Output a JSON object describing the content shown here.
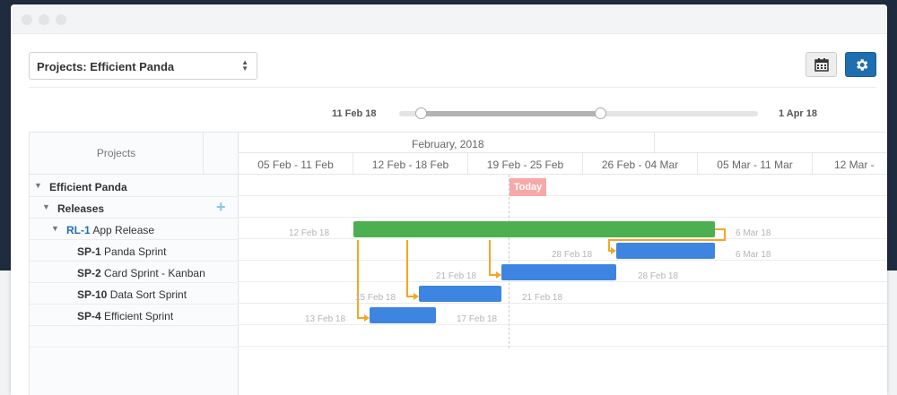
{
  "toolbar": {
    "project_select_value": "Projects: Efficient Panda",
    "calendar_button": "calendar-icon",
    "settings_button": "gear-icon",
    "accent_color": "#1f6fb0"
  },
  "date_range": {
    "start_label": "11 Feb 18",
    "end_label": "1 Apr 18",
    "selected_range_fraction": [
      0.06,
      0.56
    ]
  },
  "grid": {
    "header": "Projects",
    "rows": [
      {
        "code": "",
        "label": "Efficient Panda",
        "level": 0
      },
      {
        "code": "",
        "label": "Releases",
        "level": 1
      },
      {
        "code": "RL-1",
        "label": " App Release",
        "level": 2
      },
      {
        "code": "SP-1",
        "label": " Panda Sprint",
        "level": 3
      },
      {
        "code": "SP-2",
        "label": " Card Sprint - Kanban",
        "level": 3
      },
      {
        "code": "SP-10",
        "label": " Data Sort Sprint",
        "level": 3
      },
      {
        "code": "SP-4",
        "label": " Efficient Sprint",
        "level": 3
      }
    ]
  },
  "timeline": {
    "month": "February, 2018",
    "weeks": [
      "05 Feb - 11 Feb",
      "12 Feb - 18 Feb",
      "19 Feb - 25 Feb",
      "26 Feb - 04 Mar",
      "05 Mar - 11 Mar",
      "12 Mar -"
    ],
    "today_label": "Today"
  },
  "bars": [
    {
      "id": "RL-1",
      "start_label": "12 Feb 18",
      "end_label": "6 Mar 18",
      "color": "#4caf50"
    },
    {
      "id": "SP-1",
      "start_label": "28 Feb 18",
      "end_label": "6 Mar 18",
      "color": "#3d85e0"
    },
    {
      "id": "SP-2",
      "start_label": "21 Feb 18",
      "end_label": "28 Feb 18",
      "color": "#3d85e0"
    },
    {
      "id": "SP-10",
      "start_label": "15 Feb 18",
      "end_label": "21 Feb 18",
      "color": "#3d85e0"
    },
    {
      "id": "SP-4",
      "start_label": "13 Feb 18",
      "end_label": "17 Feb 18",
      "color": "#3d85e0"
    }
  ],
  "link_color": "#f5a623"
}
